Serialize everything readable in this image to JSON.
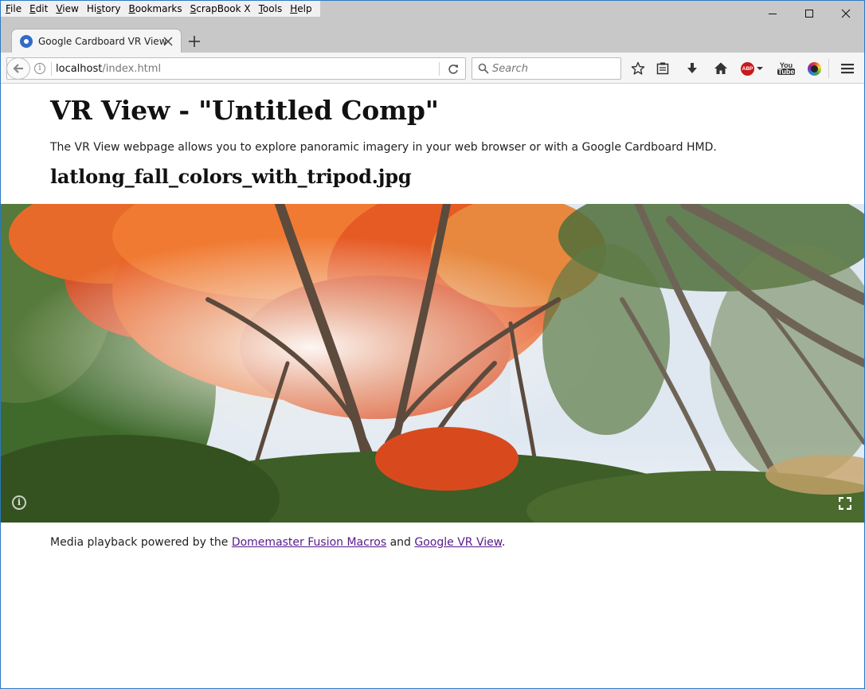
{
  "menu": [
    "File",
    "Edit",
    "View",
    "History",
    "Bookmarks",
    "ScrapBook X",
    "Tools",
    "Help"
  ],
  "menu_mnemonics": [
    "F",
    "E",
    "V",
    "s",
    "B",
    "S",
    "T",
    "H"
  ],
  "tab": {
    "title": "Google Cardboard VR View"
  },
  "address": {
    "host": "localhost",
    "path": "/index.html"
  },
  "search": {
    "placeholder": "Search"
  },
  "toolbar": {
    "abp_label": "ABP",
    "yt_top": "You",
    "yt_bottom": "Tube"
  },
  "page": {
    "title": "VR View - \"Untitled Comp\"",
    "description": "The VR View webpage allows you to explore panoramic imagery in your web browser or with a Google Cardboard HMD.",
    "subtitle": "latlong_fall_colors_with_tripod.jpg",
    "footer_prefix": "Media playback powered by the ",
    "footer_link1": "Domemaster Fusion Macros",
    "footer_mid": " and ",
    "footer_link2": "Google VR View",
    "footer_suffix": "."
  },
  "viewer": {
    "info_glyph": "i"
  },
  "colors": {
    "window_border": "#2b79c2",
    "link": "#551a8b",
    "abp": "#c8191b"
  }
}
